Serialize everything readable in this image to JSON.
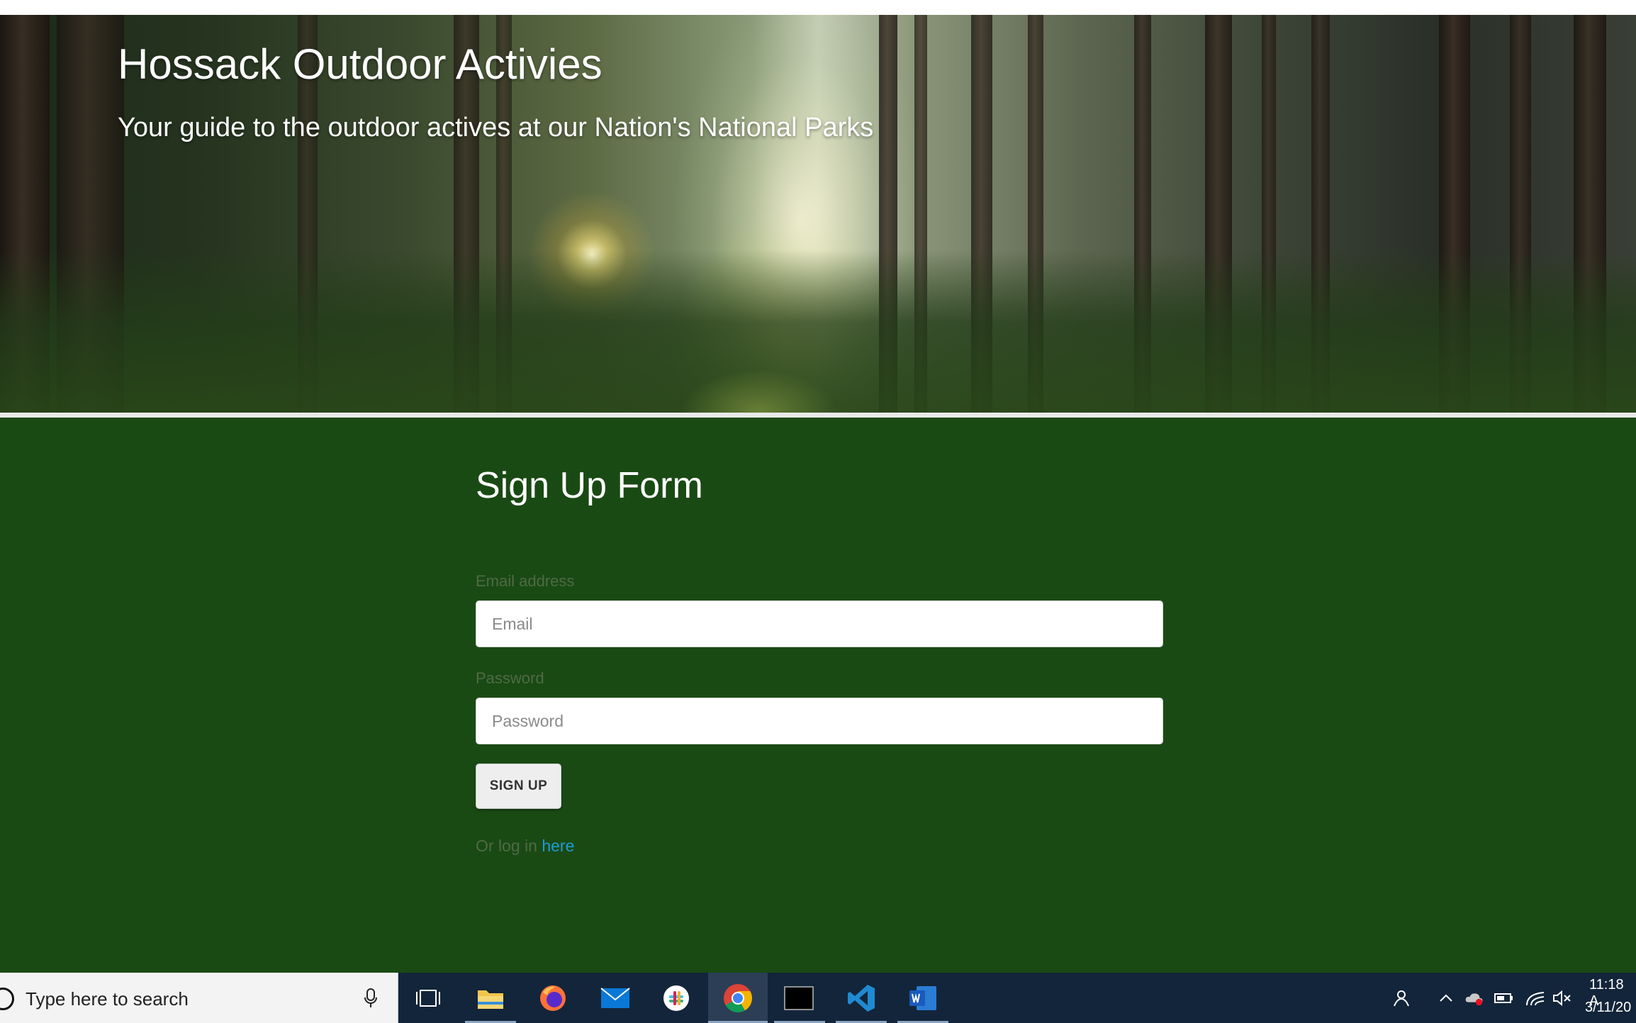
{
  "hero": {
    "title": "Hossack Outdoor Activies",
    "subtitle": "Your guide to the outdoor actives at our Nation's National Parks"
  },
  "form": {
    "title": "Sign Up Form",
    "email_label": "Email address",
    "email_placeholder": "Email",
    "email_value": "",
    "password_label": "Password",
    "password_placeholder": "Password",
    "password_value": "",
    "submit_label": "SIGN UP",
    "login_prefix": "Or log in ",
    "login_link": "here"
  },
  "colors": {
    "section_background": "#1a4a14",
    "link": "#1e9ad6",
    "taskbar": "#13253a"
  },
  "taskbar": {
    "search_placeholder": "Type here to search",
    "apps": [
      {
        "name": "task-view-icon"
      },
      {
        "name": "file-explorer-icon"
      },
      {
        "name": "firefox-icon"
      },
      {
        "name": "mail-icon"
      },
      {
        "name": "slack-icon"
      },
      {
        "name": "chrome-icon",
        "active": true
      },
      {
        "name": "terminal-icon"
      },
      {
        "name": "vscode-icon"
      },
      {
        "name": "word-icon"
      }
    ],
    "clock_time": "11:18 A",
    "clock_date": "3/11/20"
  }
}
